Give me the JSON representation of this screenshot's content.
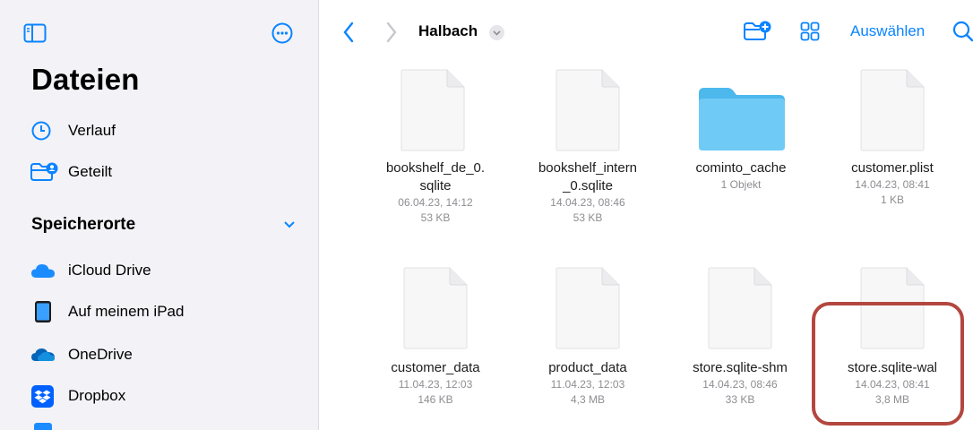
{
  "sidebar": {
    "title": "Dateien",
    "items": [
      {
        "label": "Verlauf",
        "icon": "clock-icon"
      },
      {
        "label": "Geteilt",
        "icon": "shared-folder-icon"
      }
    ],
    "locations_heading": "Speicherorte",
    "locations": [
      {
        "label": "iCloud Drive",
        "icon": "icloud-icon"
      },
      {
        "label": "Auf meinem iPad",
        "icon": "ipad-icon"
      },
      {
        "label": "OneDrive",
        "icon": "onedrive-icon"
      },
      {
        "label": "Dropbox",
        "icon": "dropbox-icon"
      }
    ]
  },
  "toolbar": {
    "folder_title": "Halbach",
    "select_label": "Auswählen"
  },
  "files": [
    {
      "name_line1": "bookshelf_de_0.",
      "name_line2": "sqlite",
      "date": "06.04.23, 14:12",
      "size": "53 KB",
      "kind": "document"
    },
    {
      "name_line1": "bookshelf_intern",
      "name_line2": "_0.sqlite",
      "date": "14.04.23, 08:46",
      "size": "53 KB",
      "kind": "document"
    },
    {
      "name_line1": "cominto_cache",
      "name_line2": "",
      "date": "1 Objekt",
      "size": "",
      "kind": "folder"
    },
    {
      "name_line1": "customer.plist",
      "name_line2": "",
      "date": "14.04.23, 08:41",
      "size": "1 KB",
      "kind": "document"
    },
    {
      "name_line1": "customer_data",
      "name_line2": "",
      "date": "11.04.23, 12:03",
      "size": "146 KB",
      "kind": "document"
    },
    {
      "name_line1": "product_data",
      "name_line2": "",
      "date": "11.04.23, 12:03",
      "size": "4,3 MB",
      "kind": "document"
    },
    {
      "name_line1": "store.sqlite-shm",
      "name_line2": "",
      "date": "14.04.23, 08:46",
      "size": "33 KB",
      "kind": "document"
    },
    {
      "name_line1": "store.sqlite-wal",
      "name_line2": "",
      "date": "14.04.23, 08:41",
      "size": "3,8 MB",
      "kind": "document"
    }
  ],
  "colors": {
    "accent": "#0a84ff",
    "highlight": "#b3473f",
    "folder": "#5ac8fa"
  }
}
